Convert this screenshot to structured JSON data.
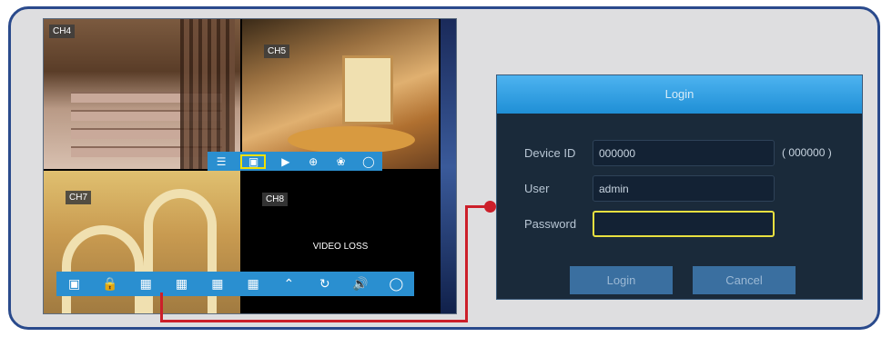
{
  "channels": {
    "ch4": "CH4",
    "ch5": "CH5",
    "ch7": "CH7",
    "ch8": "CH8",
    "video_loss": "VIDEO LOSS"
  },
  "mini_toolbar": {
    "icons": [
      "menu-list-icon",
      "camera-icon",
      "play-icon",
      "zoom-icon",
      "color-palette-icon",
      "ptz-icon"
    ],
    "selected": "camera-icon"
  },
  "main_toolbar": {
    "icons": [
      "screen-icon",
      "lock-icon",
      "layout-4-icon",
      "layout-6-icon",
      "layout-8-icon",
      "layout-9-icon",
      "scroll-up-icon",
      "rotate-icon",
      "volume-icon",
      "ptz-icon"
    ]
  },
  "login": {
    "title": "Login",
    "device_id_label": "Device ID",
    "device_id_value": "000000",
    "device_id_hint": "( 000000 )",
    "user_label": "User",
    "user_value": "admin",
    "password_label": "Password",
    "password_value": "",
    "login_button": "Login",
    "cancel_button": "Cancel"
  },
  "colors": {
    "toolbar": "#2a8fd0",
    "dialog_bg": "#1a2a3a",
    "title_bar": "#3aa5e8",
    "highlight": "#e8e040",
    "connector": "#cc1f2a",
    "frame": "#2a4a8c"
  }
}
